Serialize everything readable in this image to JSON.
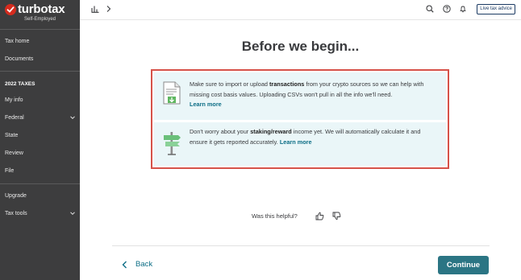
{
  "brand": {
    "name": "turbotax",
    "edition": "Self-Employed"
  },
  "sidebar": {
    "items": [
      {
        "label": "Tax home"
      },
      {
        "label": "Documents"
      },
      {
        "label": "2022 TAXES"
      },
      {
        "label": "My info"
      },
      {
        "label": "Federal"
      },
      {
        "label": "State"
      },
      {
        "label": "Review"
      },
      {
        "label": "File"
      },
      {
        "label": "Upgrade"
      },
      {
        "label": "Tax tools"
      }
    ]
  },
  "topbar": {
    "live_advice": "Live tax advice"
  },
  "page": {
    "title": "Before we begin...",
    "card1": {
      "pre": "Make sure to import or upload ",
      "bold": "transactions",
      "post": " from your crypto sources so we can help with missing cost basis values. Uploading CSVs won't pull in all the info we'll need.",
      "link": "Learn more"
    },
    "card2": {
      "pre": "Don't worry about your ",
      "bold": "staking/reward",
      "post": " income yet. We will automatically calculate it and ensure it gets reported accurately. ",
      "link": "Learn more"
    },
    "helpful": "Was this helpful?"
  },
  "footer": {
    "back": "Back",
    "continue": "Continue"
  },
  "colors": {
    "sidebar_bg": "#3d3d3e",
    "accent": "#2b7584",
    "link": "#0d6e86",
    "highlight": "#d65249",
    "card_bg": "#eaf6f8"
  }
}
